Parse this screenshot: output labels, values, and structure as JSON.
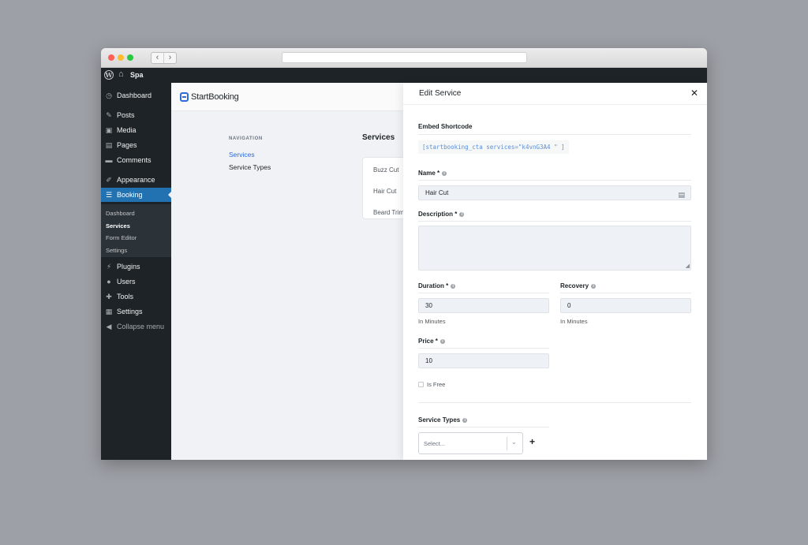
{
  "browser": {
    "back_glyph": "‹",
    "forward_glyph": "›"
  },
  "admin_bar": {
    "wp_glyph": "W",
    "home_glyph": "⌂",
    "site_name": "Spa"
  },
  "sidebar": {
    "items": [
      {
        "label": "Dashboard",
        "icon": "dashboard-icon",
        "glyph": "◷"
      },
      {
        "label": "Posts",
        "icon": "pin-icon",
        "glyph": "✎"
      },
      {
        "label": "Media",
        "icon": "media-icon",
        "glyph": "▣"
      },
      {
        "label": "Pages",
        "icon": "pages-icon",
        "glyph": "▤"
      },
      {
        "label": "Comments",
        "icon": "comments-icon",
        "glyph": "▬"
      },
      {
        "label": "Appearance",
        "icon": "brush-icon",
        "glyph": "✐"
      },
      {
        "label": "Booking",
        "icon": "booking-icon",
        "glyph": "☰"
      },
      {
        "label": "Plugins",
        "icon": "plugin-icon",
        "glyph": "⚡"
      },
      {
        "label": "Users",
        "icon": "users-icon",
        "glyph": "●"
      },
      {
        "label": "Tools",
        "icon": "wrench-icon",
        "glyph": "✚"
      },
      {
        "label": "Settings",
        "icon": "settings-icon",
        "glyph": "▦"
      },
      {
        "label": "Collapse menu",
        "icon": "collapse-icon",
        "glyph": "◀"
      }
    ],
    "submenu": [
      "Dashboard",
      "Services",
      "Form Editor",
      "Settings"
    ]
  },
  "plugin": {
    "logo_text": "StartBooking",
    "nav_heading": "NAVIGATION",
    "nav_links": [
      "Services",
      "Service Types"
    ],
    "services_title": "Services",
    "services": [
      "Buzz Cut",
      "Hair Cut",
      "Beard Trim"
    ]
  },
  "panel": {
    "title": "Edit Service",
    "close_glyph": "✕",
    "embed_label": "Embed Shortcode",
    "shortcode": "[startbooking_cta services=\"k4vnG3A4 \" ]",
    "name_label": "Name *",
    "name_value": "Hair Cut",
    "description_label": "Description *",
    "duration_label": "Duration *",
    "duration_value": "30",
    "duration_hint": "In Minutes",
    "recovery_label": "Recovery",
    "recovery_value": "0",
    "recovery_hint": "In Minutes",
    "price_label": "Price *",
    "price_value": "10",
    "is_free_label": "Is Free",
    "service_types_label": "Service Types",
    "select_placeholder": "Select...",
    "plus_glyph": "+",
    "info_glyph": "i",
    "card_glyph": "▤",
    "chevron_glyph": "⌄",
    "resize_glyph": "◢"
  },
  "colors": {
    "wp_dark": "#1d2327",
    "wp_blue": "#2271b1",
    "link_blue": "#2d6bd9",
    "field_bg": "#eef1f5"
  }
}
